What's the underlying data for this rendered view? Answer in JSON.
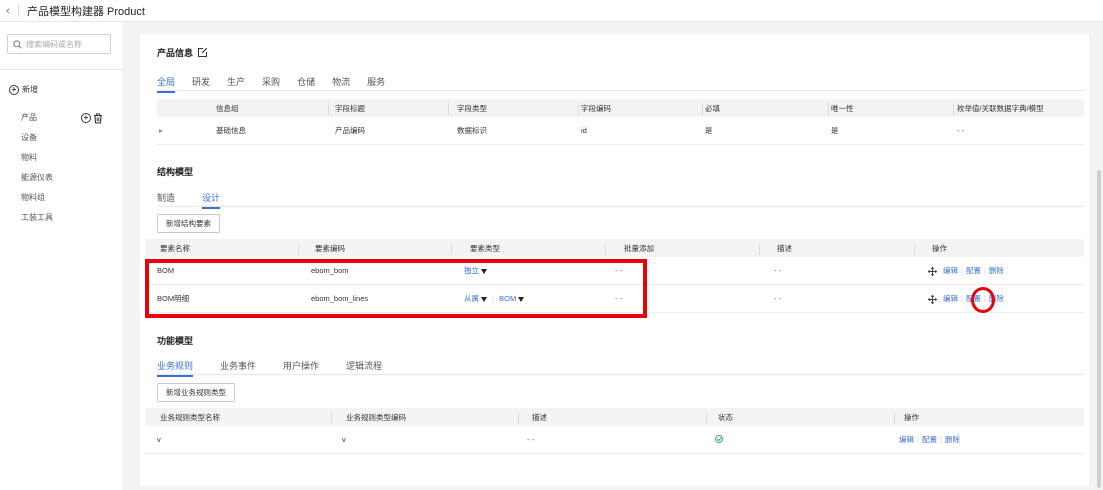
{
  "topbar": {
    "back_icon": "chevron-left-icon",
    "title": "产品模型构建器 Product"
  },
  "sidebar": {
    "search_placeholder": "搜索编码或名称",
    "new_label": "新增",
    "items": [
      {
        "label": "产品"
      },
      {
        "label": "设备"
      },
      {
        "label": "物料"
      },
      {
        "label": "能源仪表"
      },
      {
        "label": "物料组"
      },
      {
        "label": "工装工具"
      }
    ]
  },
  "product_info": {
    "title": "产品信息",
    "tabs": [
      "全局",
      "研发",
      "生产",
      "采购",
      "仓储",
      "物流",
      "服务"
    ],
    "active_tab": "全局",
    "columns": [
      "信息组",
      "字段标题",
      "字段类型",
      "字段编码",
      "必填",
      "唯一性",
      "枚举值/关联数据字典/模型"
    ],
    "rows": [
      [
        "基础信息",
        "产品编码",
        "数据标识",
        "id",
        "是",
        "是",
        "- -"
      ]
    ]
  },
  "structure_model": {
    "title": "结构模型",
    "tabs": [
      "制造",
      "设计"
    ],
    "active_tab": "设计",
    "add_button": "新增结构要素",
    "columns": [
      "要素名称",
      "要素编码",
      "要素类型",
      "批量添加",
      "描述",
      "操作"
    ],
    "rows": [
      {
        "name": "BOM",
        "code": "ebom_bom",
        "type": "独立",
        "ref": "",
        "batch": "- -",
        "desc": "- -"
      },
      {
        "name": "BOM明细",
        "code": "ebom_bom_lines",
        "type": "从属",
        "ref": "BOM",
        "batch": "- -",
        "desc": "- -"
      }
    ],
    "actions": [
      "编辑",
      "配置",
      "删除"
    ]
  },
  "function_model": {
    "title": "功能模型",
    "tabs": [
      "业务规则",
      "业务事件",
      "用户操作",
      "逻辑流程"
    ],
    "active_tab": "业务规则",
    "add_button": "新增业务规则类型",
    "columns": [
      "业务规则类型名称",
      "业务规则类型编码",
      "描述",
      "状态",
      "操作"
    ],
    "rows": [
      {
        "name": "v",
        "code": "v",
        "desc": "- -",
        "status_icon": "check-circle-icon"
      }
    ],
    "actions": [
      "编辑",
      "配置",
      "删除"
    ]
  },
  "colors": {
    "accent": "#3a6fd8",
    "highlight": "#e8000b",
    "success": "#35b36a"
  }
}
